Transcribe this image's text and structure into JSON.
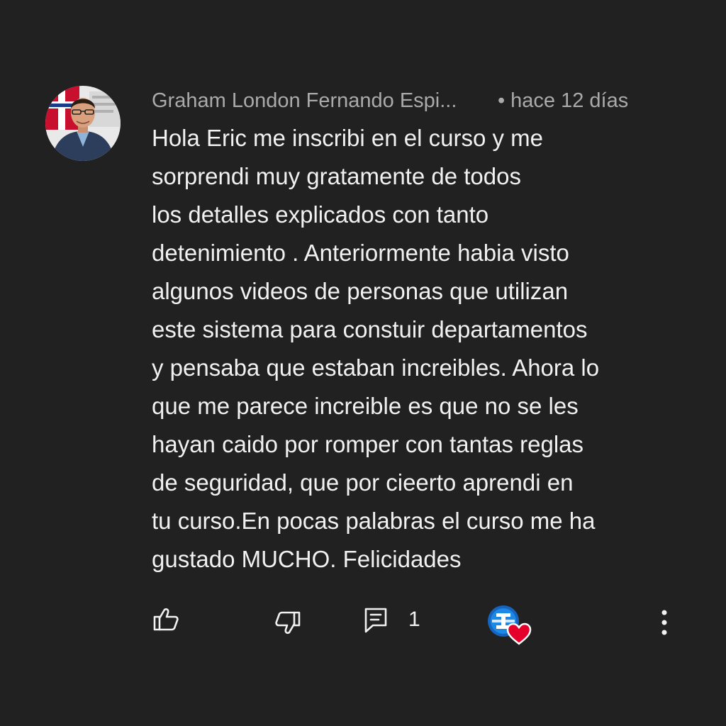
{
  "comment": {
    "author": "Graham London Fernando Espi...",
    "separator": "•",
    "timestamp": "hace 12 días",
    "text_lines": [
      "Hola Eric me inscribi en el curso y me",
      "sorprendi muy gratamente de todos",
      "los detalles explicados con tanto",
      "detenimiento . Anteriormente habia visto",
      "algunos videos de personas que utilizan",
      "este sistema para constuir departamentos",
      "y pensaba que estaban increibles. Ahora lo",
      "que me parece increible es que no se les",
      "hayan caido por romper con tantas reglas",
      "de seguridad, que por cieerto aprendi en",
      "tu curso.En pocas palabras el curso me ha",
      "gustado MUCHO. Felicidades"
    ]
  },
  "actions": {
    "like_icon": "thumbs-up-icon",
    "dislike_icon": "thumbs-down-icon",
    "reply_icon": "comment-icon",
    "reply_count": "1",
    "creator_heart_icon": "creator-heart-icon",
    "more_icon": "more-vert-icon"
  },
  "colors": {
    "background": "#212121",
    "text_primary": "#f1f1f1",
    "text_secondary": "#aaaaaa",
    "heart": "#e4002b"
  }
}
